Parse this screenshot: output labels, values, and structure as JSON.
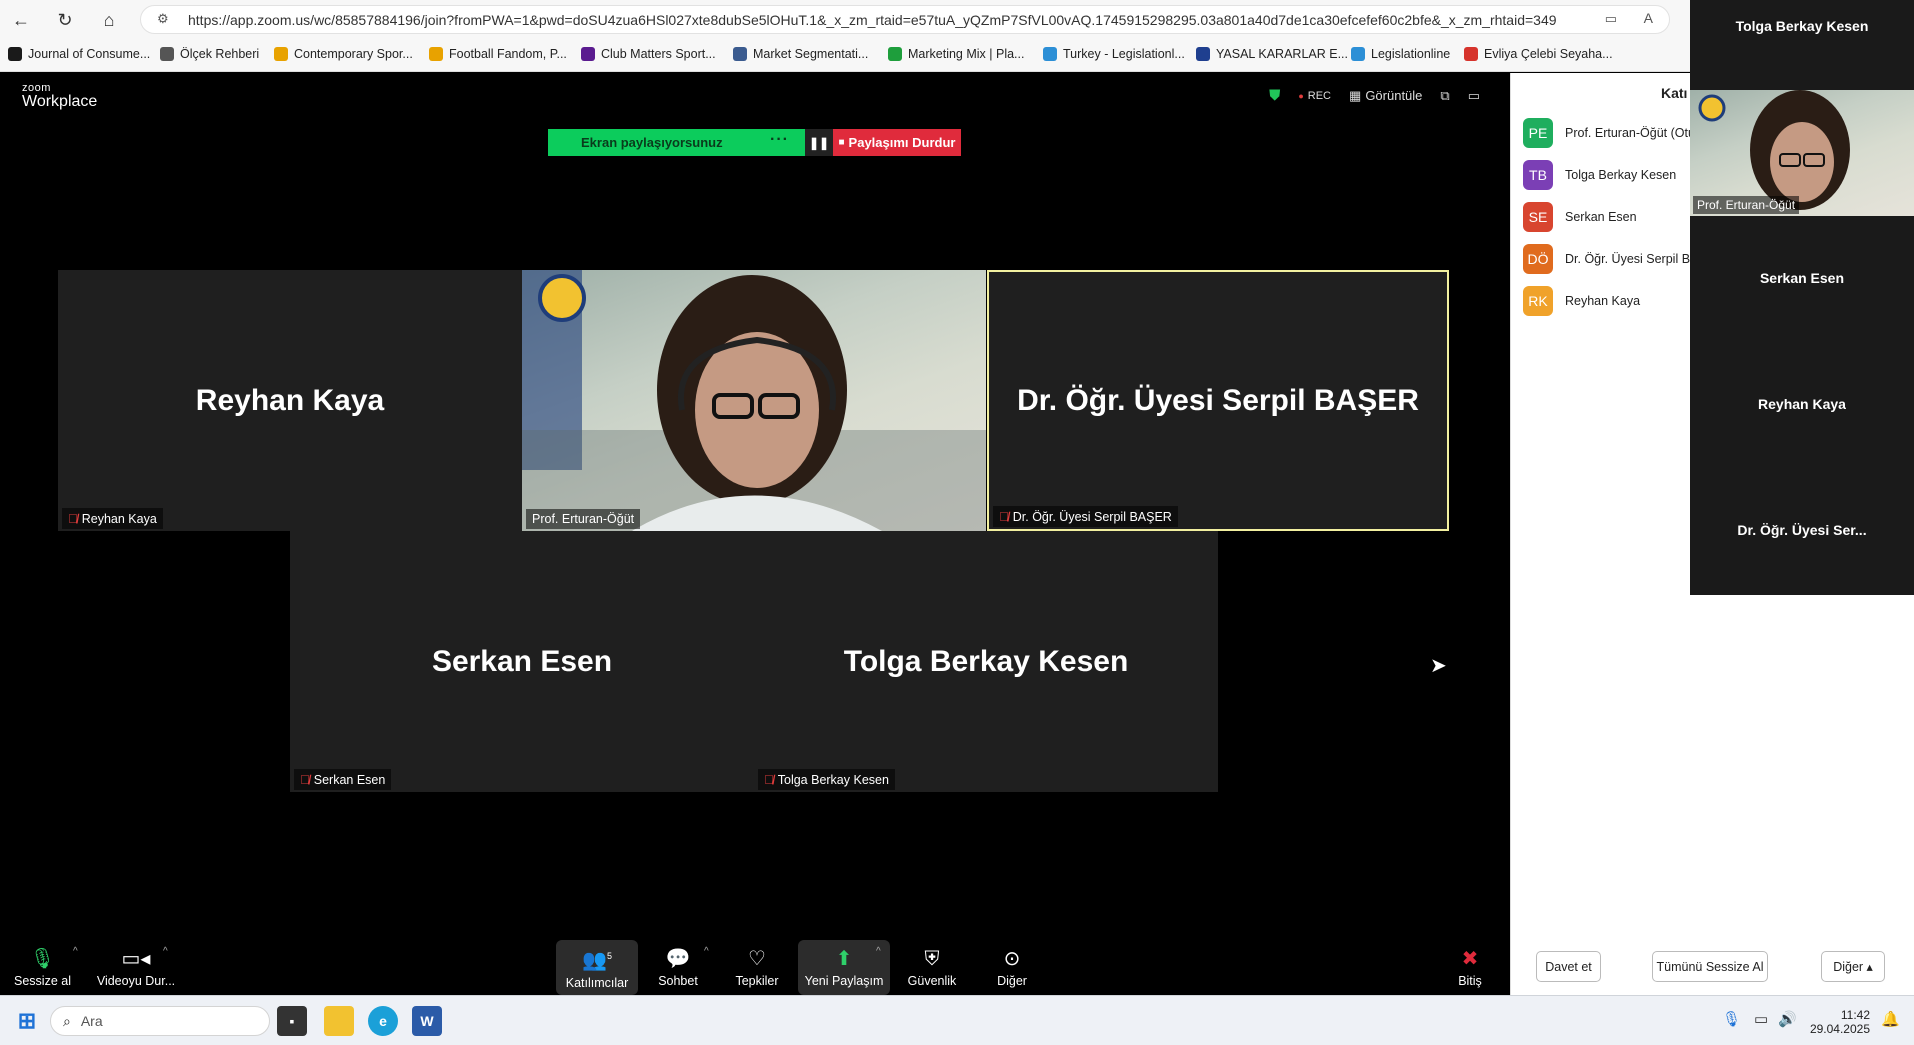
{
  "browser": {
    "url": "https://app.zoom.us/wc/85857884196/join?fromPWA=1&pwd=doSU4zua6HSl027xte8dubSe5lOHuT.1&_x_zm_rtaid=e57tuA_yQZmP7SfVL00vAQ.1745915298295.03a801a40d7de1ca30efcefef60c2bfe&_x_zm_rhtaid=349",
    "bookmarks": [
      {
        "label": "Journal of Consume...",
        "color": "#1a1a1a"
      },
      {
        "label": "Ölçek Rehberi",
        "color": "#555555"
      },
      {
        "label": "Contemporary Spor...",
        "color": "#e8a200"
      },
      {
        "label": "Football Fandom, P...",
        "color": "#e8a200"
      },
      {
        "label": "Club Matters Sport...",
        "color": "#5a1b8f"
      },
      {
        "label": "Market Segmentati...",
        "color": "#3b5b8f"
      },
      {
        "label": "Marketing Mix | Pla...",
        "color": "#1e9e3c"
      },
      {
        "label": "Turkey - Legislationl...",
        "color": "#2c8fd6"
      },
      {
        "label": "YASAL KARARLAR E...",
        "color": "#1f3f8f"
      },
      {
        "label": "Legislationline",
        "color": "#2c8fd6"
      },
      {
        "label": "Evliya Çelebi Seyaha...",
        "color": "#d6332c"
      }
    ]
  },
  "zoom": {
    "logo_small": "zoom",
    "logo_big": "Workplace",
    "rec": "REC",
    "view_label": "Görüntüle",
    "share_bar": {
      "status": "Ekran paylaşıyorsunuz",
      "dots": "···",
      "pause": "❚❚",
      "stop": "Paylaşımı Durdur"
    },
    "tiles": [
      {
        "name": "Reyhan Kaya",
        "label": "Reyhan Kaya"
      },
      {
        "name": "",
        "label": "Prof. Erturan-Öğüt"
      },
      {
        "name": "Dr. Öğr. Üyesi Serpil BAŞER",
        "label": "Dr. Öğr. Üyesi Serpil BAŞER"
      },
      {
        "name": "Serkan Esen",
        "label": "Serkan Esen"
      },
      {
        "name": "Tolga Berkay Kesen",
        "label": "Tolga Berkay Kesen"
      }
    ],
    "toolbar": {
      "mute": "Sessize al",
      "video": "Videoyu Dur...",
      "participants": "Katılımcılar",
      "participants_count": "5",
      "chat": "Sohbet",
      "reactions": "Tepkiler",
      "new_share": "Yeni Paylaşım",
      "security": "Güvenlik",
      "more": "Diğer",
      "end": "Bitiş"
    }
  },
  "panel": {
    "title": "Katı",
    "participants": [
      {
        "initials": "PE",
        "name": "Prof. Erturan-Öğüt (Otu",
        "color": "#1fae5e"
      },
      {
        "initials": "TB",
        "name": "Tolga Berkay Kesen",
        "color": "#7b3fb5"
      },
      {
        "initials": "SE",
        "name": "Serkan Esen",
        "color": "#d8452f"
      },
      {
        "initials": "DÖ",
        "name": "Dr. Öğr. Üyesi Serpil BA",
        "color": "#e06b1e"
      },
      {
        "initials": "RK",
        "name": "Reyhan Kaya",
        "color": "#f0a22a"
      }
    ],
    "invite": "Davet et",
    "mute_all": "Tümünü Sessize Al",
    "more": "Diğer ▴"
  },
  "float_strip": {
    "names": [
      "Tolga Berkay Kesen",
      "Prof. Erturan-Öğüt",
      "Serkan Esen",
      "Reyhan Kaya",
      "Dr. Öğr. Üyesi Ser..."
    ]
  },
  "taskbar": {
    "search_placeholder": "Ara",
    "time": "11:42",
    "date": "29.04.2025"
  }
}
